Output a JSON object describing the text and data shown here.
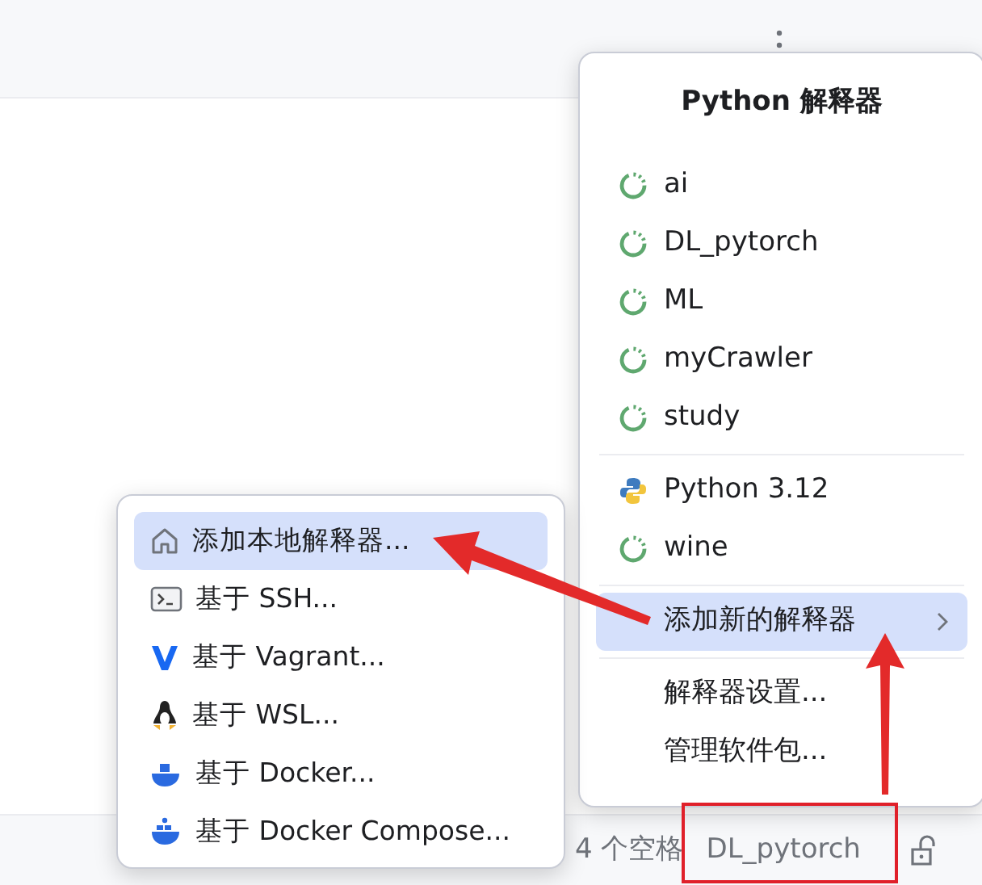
{
  "interpreter_popup": {
    "title": "Python 解释器",
    "virtual_envs": [
      {
        "name": "ai",
        "kind": "env"
      },
      {
        "name": "DL_pytorch",
        "kind": "env"
      },
      {
        "name": "ML",
        "kind": "env"
      },
      {
        "name": "myCrawler",
        "kind": "env"
      },
      {
        "name": "study",
        "kind": "env"
      }
    ],
    "other_interpreters": [
      {
        "name": "Python 3.12",
        "kind": "python"
      },
      {
        "name": "wine",
        "kind": "env"
      }
    ],
    "actions": [
      {
        "label": "添加新的解释器",
        "selected": true,
        "submenu": true
      },
      {
        "label": "解释器设置...",
        "selected": false,
        "submenu": false
      },
      {
        "label": "管理软件包...",
        "selected": false,
        "submenu": false
      }
    ]
  },
  "add_submenu": {
    "items": [
      {
        "label": "添加本地解释器...",
        "kind": "local",
        "selected": true
      },
      {
        "label": "基于 SSH...",
        "kind": "ssh",
        "selected": false
      },
      {
        "label": "基于 Vagrant...",
        "kind": "vagrant",
        "selected": false
      },
      {
        "label": "基于 WSL...",
        "kind": "wsl",
        "selected": false
      },
      {
        "label": "基于 Docker...",
        "kind": "docker",
        "selected": false
      },
      {
        "label": "基于 Docker Compose...",
        "kind": "compose",
        "selected": false
      }
    ]
  },
  "status_bar": {
    "indent": "4 个空格",
    "interpreter": "DL_pytorch"
  }
}
